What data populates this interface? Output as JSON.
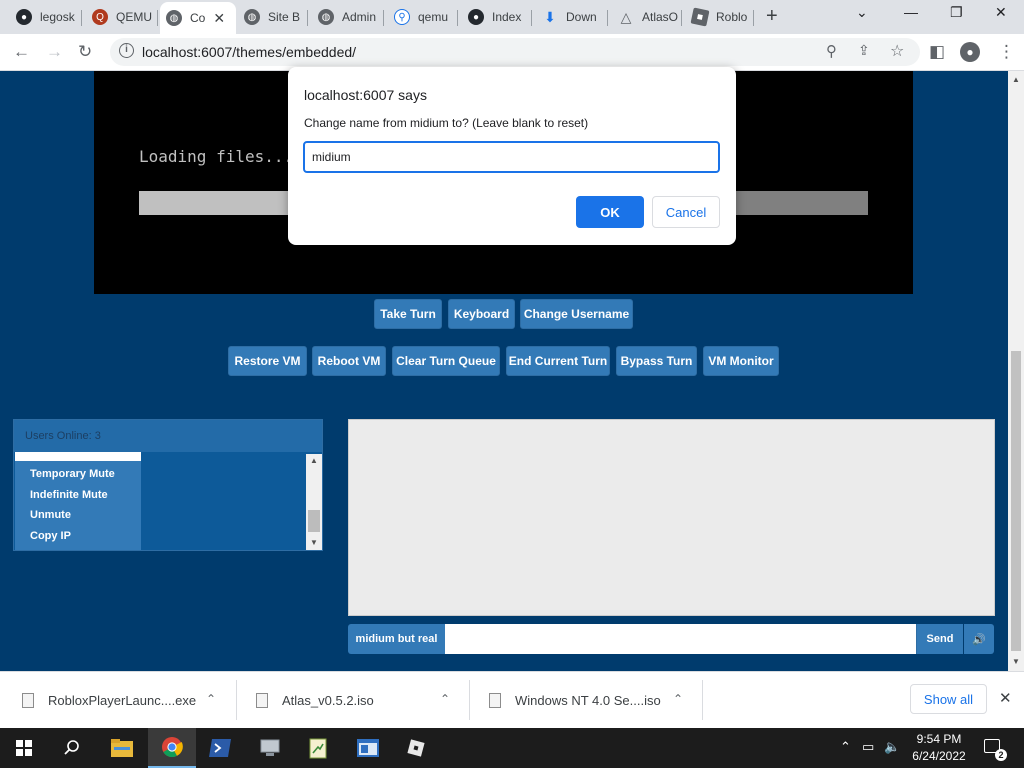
{
  "browser": {
    "tabs": [
      {
        "label": "legosk",
        "icon": "github-icon"
      },
      {
        "label": "QEMU",
        "icon": "qemu-icon"
      },
      {
        "label": "Co",
        "icon": "globe-icon",
        "active": true
      },
      {
        "label": "Site B",
        "icon": "globe-icon"
      },
      {
        "label": "Admin",
        "icon": "globe-icon"
      },
      {
        "label": "qemu",
        "icon": "search-icon"
      },
      {
        "label": "Index",
        "icon": "github-icon"
      },
      {
        "label": "Down",
        "icon": "download-icon"
      },
      {
        "label": "AtlasO",
        "icon": "atlas-icon"
      },
      {
        "label": "Roblo",
        "icon": "roblox-icon"
      }
    ],
    "url": "localhost:6007/themes/embedded/"
  },
  "vm": {
    "loading_text": "Loading files...",
    "progress": 0.6
  },
  "controls": {
    "row1": [
      "Take Turn",
      "Keyboard",
      "Change Username"
    ],
    "row2": [
      "Restore VM",
      "Reboot VM",
      "Clear Turn Queue",
      "End Current Turn",
      "Bypass Turn",
      "VM Monitor"
    ]
  },
  "users": {
    "header": "Users Online: 3",
    "menu_items": [
      "Temporary Mute",
      "Indefinite Mute",
      "Unmute",
      "Copy IP"
    ]
  },
  "chat": {
    "username": "midium but real",
    "input_value": "",
    "send_label": "Send"
  },
  "dialog": {
    "origin": "localhost:6007 says",
    "message": "Change name from midium to? (Leave blank to reset)",
    "input_value": "midium",
    "ok_label": "OK",
    "cancel_label": "Cancel"
  },
  "downloads": {
    "items": [
      "RobloxPlayerLaunc....exe",
      "Atlas_v0.5.2.iso",
      "Windows NT 4.0 Se....iso"
    ],
    "show_all": "Show all"
  },
  "taskbar": {
    "time": "9:54 PM",
    "date": "6/24/2022"
  }
}
